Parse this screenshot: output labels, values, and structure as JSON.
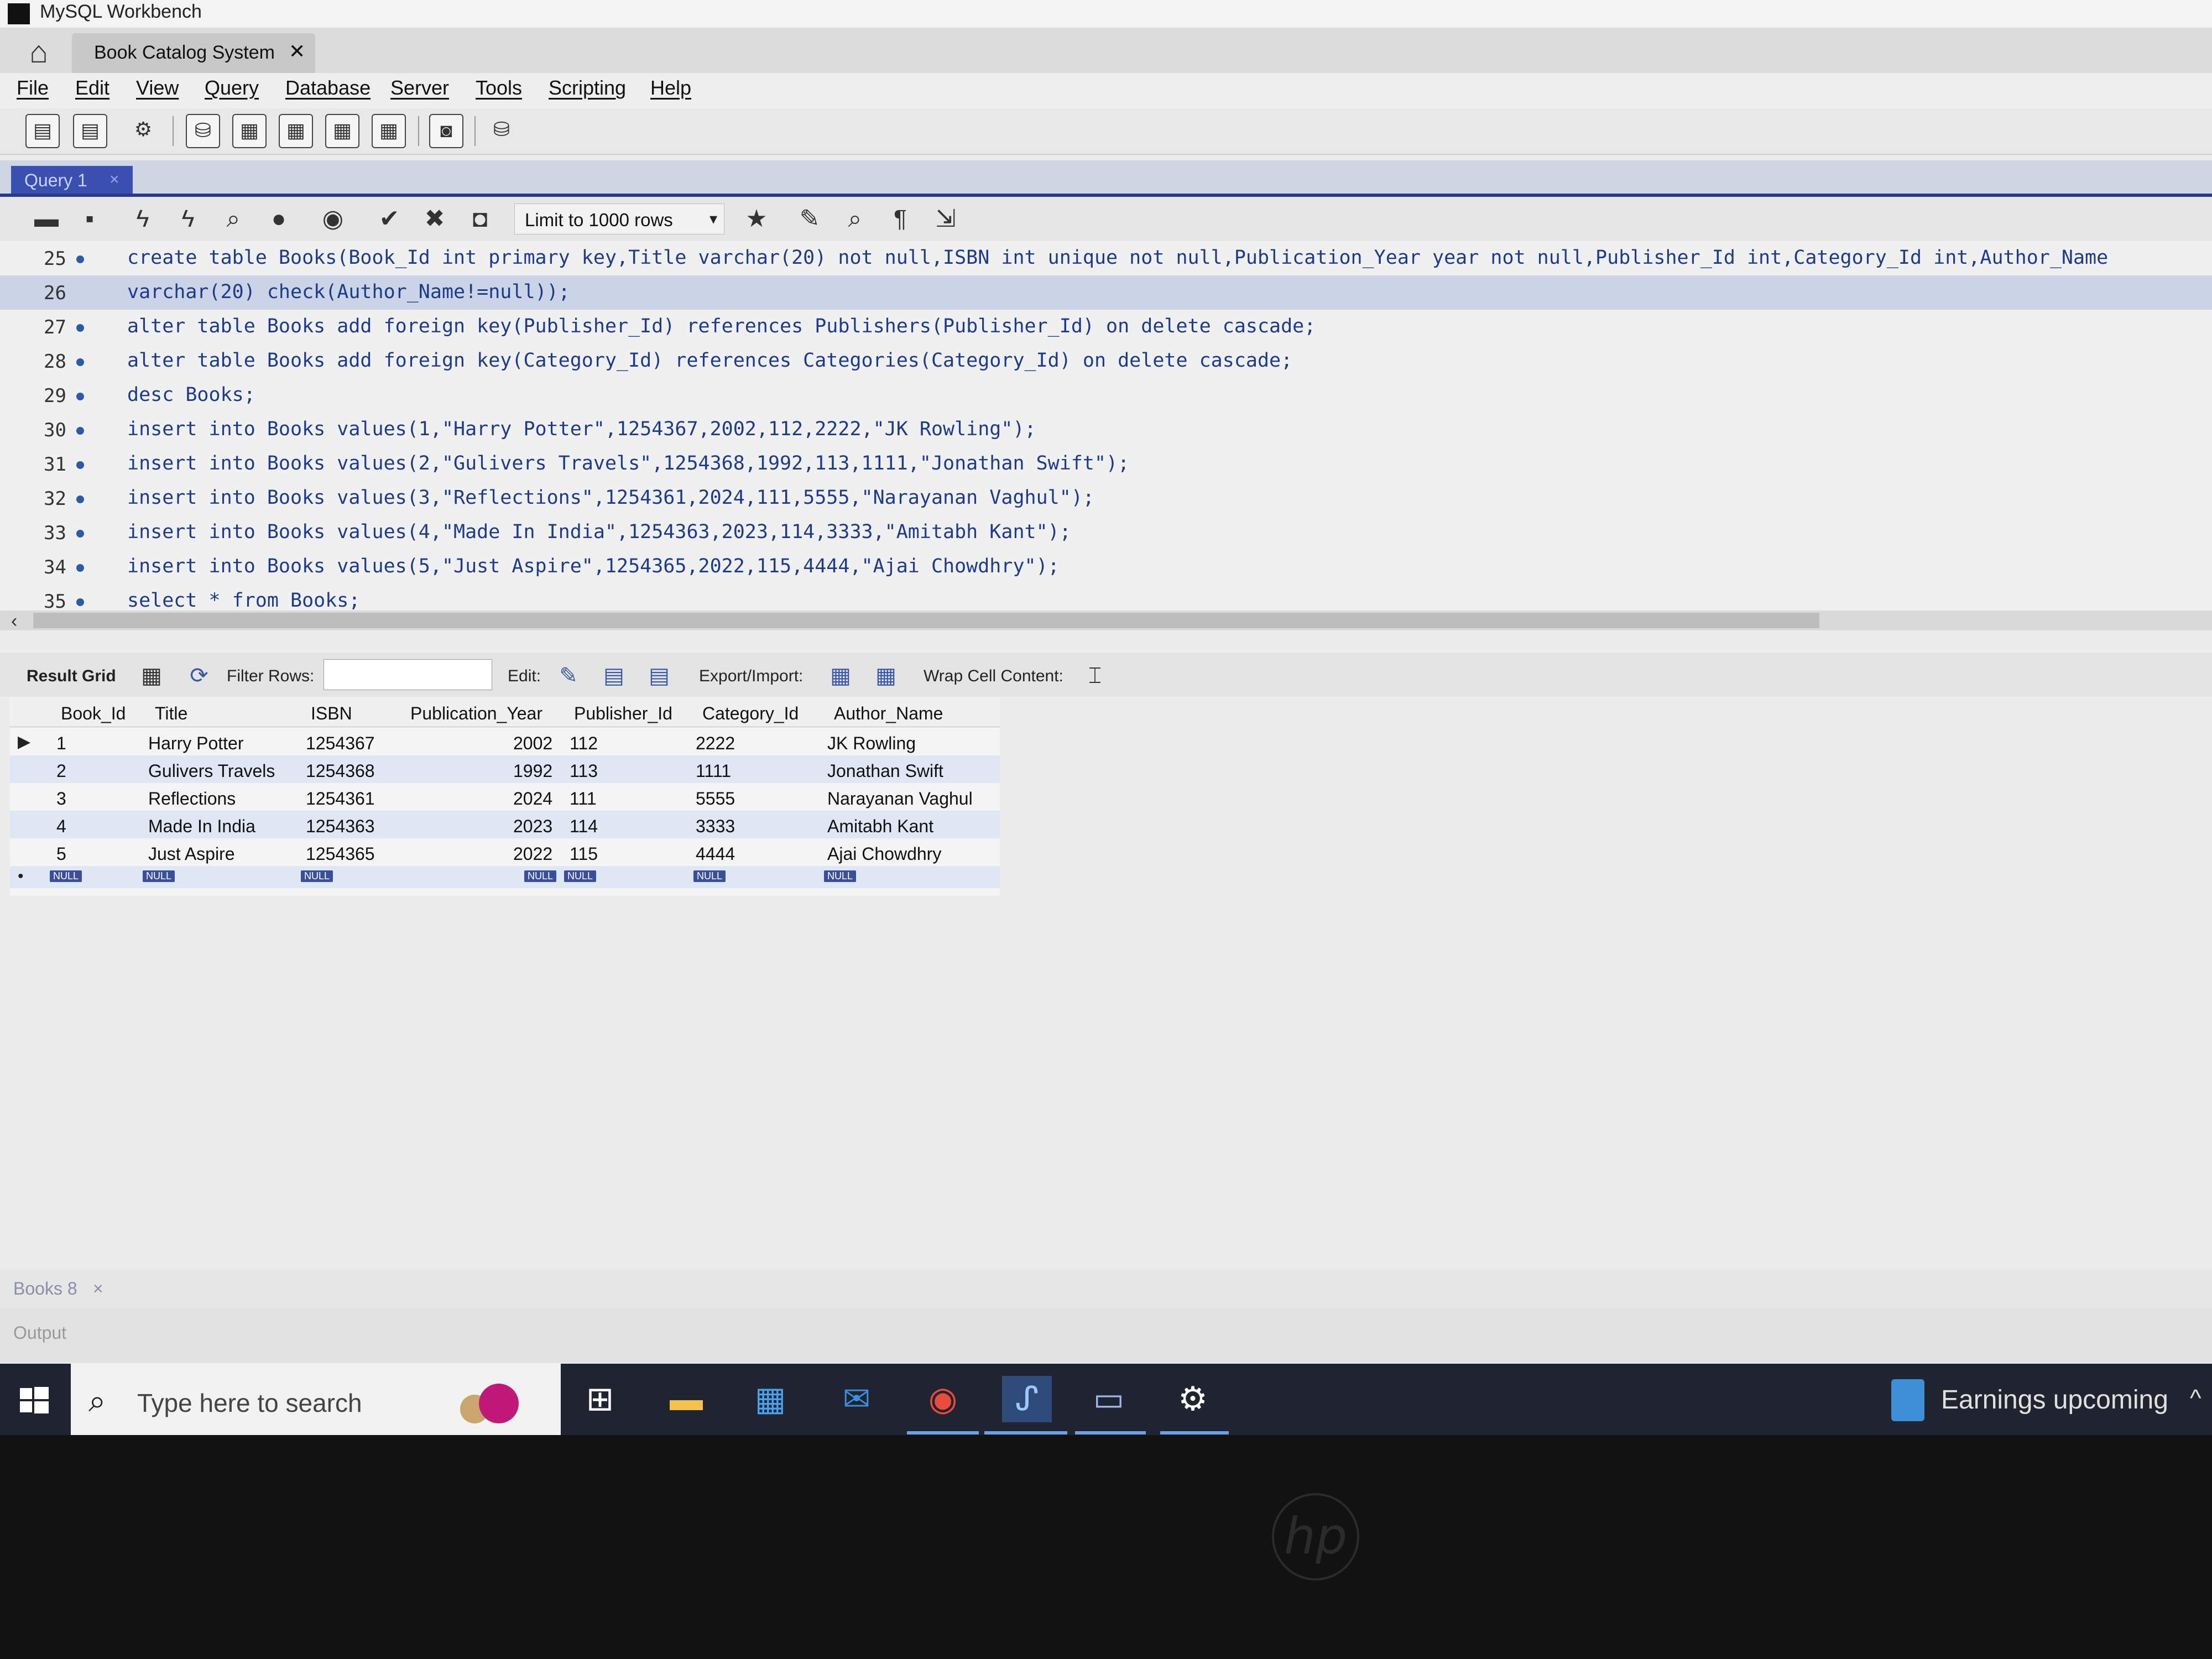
{
  "window": {
    "title": "MySQL Workbench"
  },
  "connection_tab": {
    "label": "Book Catalog System",
    "close": "✕"
  },
  "menu": [
    "File",
    "Edit",
    "View",
    "Query",
    "Database",
    "Server",
    "Tools",
    "Scripting",
    "Help"
  ],
  "query_tab": {
    "label": "Query 1",
    "close": "×"
  },
  "query_toolbar": {
    "limit_label": "Limit to 1000 rows",
    "limit_arrow": "▾"
  },
  "editor": {
    "lines": [
      {
        "no": "25",
        "text": "create table Books(Book_Id int primary key,Title varchar(20) not null,ISBN int unique not null,Publication_Year year not null,Publisher_Id int,Category_Id int,Author_Name"
      },
      {
        "no": "26",
        "text": "varchar(20) check(Author_Name!=null));"
      },
      {
        "no": "27",
        "text": "alter table Books add foreign key(Publisher_Id) references Publishers(Publisher_Id) on delete cascade;"
      },
      {
        "no": "28",
        "text": "alter table Books add foreign key(Category_Id) references Categories(Category_Id) on delete cascade;"
      },
      {
        "no": "29",
        "text": "desc Books;"
      },
      {
        "no": "30",
        "text": "insert into Books values(1,\"Harry Potter\",1254367,2002,112,2222,\"JK Rowling\");"
      },
      {
        "no": "31",
        "text": "insert into Books values(2,\"Gulivers Travels\",1254368,1992,113,1111,\"Jonathan Swift\");"
      },
      {
        "no": "32",
        "text": "insert into Books values(3,\"Reflections\",1254361,2024,111,5555,\"Narayanan Vaghul\");"
      },
      {
        "no": "33",
        "text": "insert into Books values(4,\"Made In India\",1254363,2023,114,3333,\"Amitabh Kant\");"
      },
      {
        "no": "34",
        "text": "insert into Books values(5,\"Just Aspire\",1254365,2022,115,4444,\"Ajai Chowdhry\");"
      },
      {
        "no": "35",
        "text": "select * from Books;"
      }
    ]
  },
  "result_toolbar": {
    "result_grid": "Result Grid",
    "filter_rows": "Filter Rows:",
    "edit": "Edit:",
    "export_import": "Export/Import:",
    "wrap_cell": "Wrap Cell Content:"
  },
  "grid": {
    "columns": [
      "Book_Id",
      "Title",
      "ISBN",
      "Publication_Year",
      "Publisher_Id",
      "Category_Id",
      "Author_Name"
    ],
    "rows": [
      [
        "1",
        "Harry Potter",
        "1254367",
        "2002",
        "112",
        "2222",
        "JK Rowling"
      ],
      [
        "2",
        "Gulivers Travels",
        "1254368",
        "1992",
        "113",
        "1111",
        "Jonathan Swift"
      ],
      [
        "3",
        "Reflections",
        "1254361",
        "2024",
        "111",
        "5555",
        "Narayanan Vaghul"
      ],
      [
        "4",
        "Made In India",
        "1254363",
        "2023",
        "114",
        "3333",
        "Amitabh Kant"
      ],
      [
        "5",
        "Just Aspire",
        "1254365",
        "2022",
        "115",
        "4444",
        "Ajai Chowdhry"
      ]
    ],
    "null_label": "NULL"
  },
  "results_tab": {
    "label": "Books 8",
    "close": "×"
  },
  "output": {
    "label": "Output"
  },
  "taskbar": {
    "search_placeholder": "Type here to search",
    "news": "Earnings upcoming"
  },
  "brand": "hp"
}
